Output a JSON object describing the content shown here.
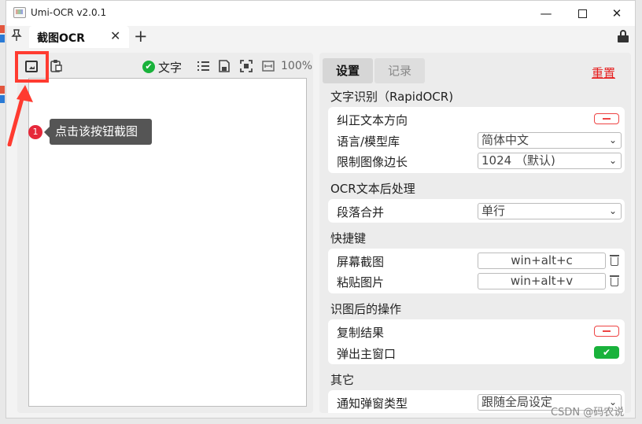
{
  "window": {
    "title": "Umi-OCR v2.0.1"
  },
  "tabs": [
    {
      "label": "截图OCR"
    }
  ],
  "icons": {
    "app": "app-icon",
    "minimize": "minimize-icon",
    "maximize": "maximize-icon",
    "close": "close-icon",
    "pin": "pin-icon",
    "tab_close": "close-icon",
    "tab_add": "plus-icon",
    "lock": "lock-icon",
    "screenshot": "screenshot-icon",
    "paste": "paste-icon",
    "list": "list-icon",
    "save": "save-icon",
    "scan": "scan-icon",
    "fit": "fit-icon",
    "trash": "trash-icon"
  },
  "glyphs": {
    "minimize": "—",
    "close": "✕",
    "pin": "📌",
    "tab_close": "✕",
    "tab_add": "+",
    "check": "✔",
    "chevron": "⌄"
  },
  "left": {
    "toolbar": {
      "text_label": "文字",
      "zoom": "100%",
      "text_toggle_on": true
    },
    "annotation": {
      "step_number": "1",
      "tooltip": "点击该按钮截图"
    }
  },
  "right": {
    "tabs": [
      "设置",
      "记录"
    ],
    "reset": "重置",
    "sections": {
      "ocr": {
        "title": "文字识别（RapidOCR)",
        "rows": {
          "correct_direction": "纠正文本方向",
          "language": "语言/模型库",
          "limit_size": "限制图像边长"
        },
        "language_value": "简体中文",
        "limit_value": "1024 （默认)",
        "correct_direction_on": false
      },
      "post": {
        "title": "OCR文本后处理",
        "rows": {
          "merge": "段落合并"
        },
        "merge_value": "单行"
      },
      "hotkeys": {
        "title": "快捷键",
        "rows": {
          "screenshot": "屏幕截图",
          "paste": "粘贴图片"
        },
        "screenshot_value": "win+alt+c",
        "paste_value": "win+alt+v"
      },
      "after": {
        "title": "识图后的操作",
        "rows": {
          "copy": "复制结果",
          "popup": "弹出主窗口"
        },
        "copy_on": false,
        "popup_on": true
      },
      "other": {
        "title": "其它",
        "rows": {
          "popup_type": "通知弹窗类型"
        },
        "popup_type_value": "跟随全局设定"
      }
    }
  },
  "colors": {
    "accent_red": "#ff3b30",
    "toggle_green": "#19b23b",
    "reset_red": "#e61e1e"
  },
  "watermark": "CSDN @码农说"
}
